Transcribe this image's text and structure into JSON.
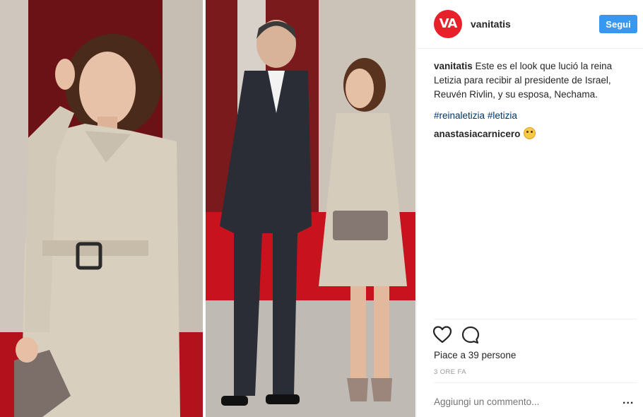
{
  "post": {
    "username": "vanitatis",
    "avatar_text": "VA",
    "follow_label": "Segui",
    "caption": {
      "author": "vanitatis",
      "text": "Este es el look que lució la reina Letizia para recibir al presidente de Israel, Reuvén Rivlin, y su esposa, Nechama."
    },
    "hashtags": [
      "#reinaletizia",
      "#letizia"
    ],
    "comment": {
      "author": "anastasiacarnicero"
    },
    "likes_text": "Piace a 39 persone",
    "time_text": "3 ORE FA",
    "add_comment_placeholder": "Aggiungi un commento...",
    "more_label": "..."
  },
  "icons": {
    "like": "heart-icon",
    "comment": "comment-icon",
    "more": "more-options-icon",
    "emoji": "flushed-face-emoji"
  },
  "colors": {
    "brand_red": "#e8202a",
    "follow_blue": "#3897f0",
    "hashtag": "#003569",
    "muted": "#999999"
  }
}
